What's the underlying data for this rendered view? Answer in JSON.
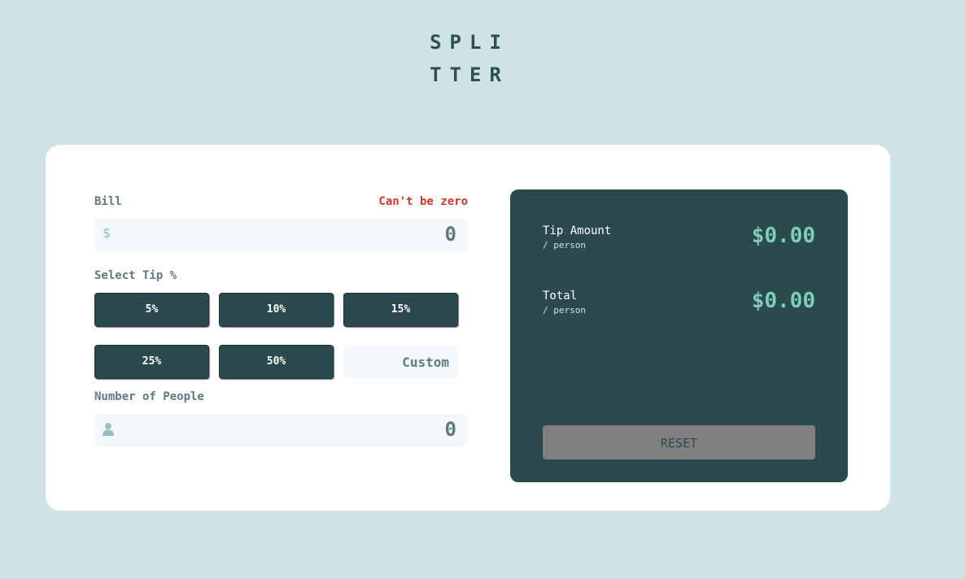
{
  "logo": {
    "line1": "SPLI",
    "line2": "TTER"
  },
  "bill": {
    "label": "Bill",
    "error": "Can't be zero",
    "prefix": "$",
    "value": "0"
  },
  "tip": {
    "label": "Select Tip %",
    "options": [
      "5%",
      "10%",
      "15%",
      "25%",
      "50%"
    ],
    "custom_placeholder": "Custom"
  },
  "people": {
    "label": "Number of People",
    "value": "0"
  },
  "results": {
    "tip_amount_label": "Tip Amount",
    "tip_amount_sub": "/ person",
    "tip_amount_value": "$0.00",
    "total_label": "Total",
    "total_sub": "/ person",
    "total_value": "$0.00",
    "reset_label": "RESET"
  },
  "colors": {
    "background": "#cfe2e6",
    "dark_green": "#2a4a4d",
    "accent": "#7fcdb6",
    "error": "#d0382f"
  }
}
